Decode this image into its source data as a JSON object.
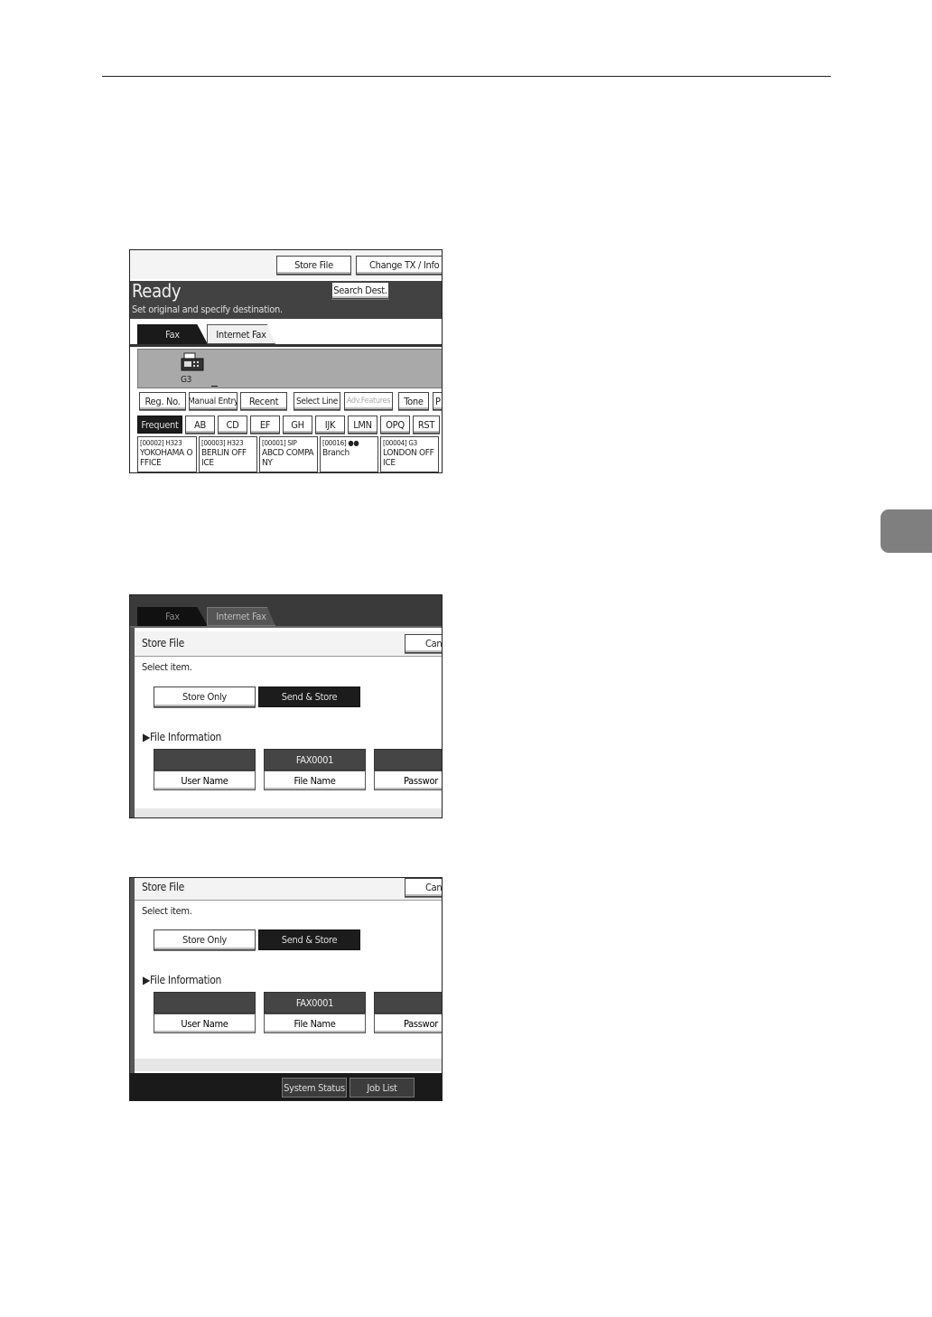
{
  "panel1": {
    "store_file": "Store File",
    "change_tx": "Change TX / Info",
    "ready": "Ready",
    "instruction": "Set original and specify destination.",
    "search_dest": "Search Dest.",
    "tab_fax": "Fax",
    "tab_internet_fax": "Internet Fax",
    "line": "G3",
    "toolbar": [
      "Reg. No.",
      "Manual Entry",
      "Recent",
      "Select Line",
      "Adv.Features",
      "Tone",
      "P"
    ],
    "index_tabs": [
      "Frequent",
      "AB",
      "CD",
      "EF",
      "GH",
      "IJK",
      "LMN",
      "OPQ",
      "RST"
    ],
    "destinations": [
      {
        "code": "[00002] H323",
        "name": "YOKOHAMA O",
        "name2": "FFICE"
      },
      {
        "code": "[00003] H323",
        "name": "BERLIN OFF",
        "name2": "ICE"
      },
      {
        "code": "[00001] SIP",
        "name": "ABCD COMPA",
        "name2": "NY"
      },
      {
        "code": "[00016]",
        "name": "Branch",
        "name2": ""
      },
      {
        "code": "[00004] G3",
        "name": "LONDON OFF",
        "name2": "ICE"
      }
    ]
  },
  "panel2": {
    "tab_fax": "Fax",
    "tab_internet_fax": "Internet Fax",
    "title": "Store File",
    "cancel": "Can",
    "select_item": "Select item.",
    "store_only": "Store Only",
    "send_store": "Send & Store",
    "file_info": "▶File Information",
    "user_name_value": "",
    "file_name_value": "FAX0001",
    "user_name": "User Name",
    "file_name": "File Name",
    "password": "Passwor"
  },
  "panel3": {
    "title": "Store File",
    "cancel": "Can",
    "select_item": "Select item.",
    "store_only": "Store Only",
    "send_store": "Send & Store",
    "file_info": "▶File Information",
    "user_name_value": "",
    "file_name_value": "FAX0001",
    "user_name": "User Name",
    "file_name": "File Name",
    "password": "Passwor",
    "system_status": "System Status",
    "job_list": "Job List"
  }
}
